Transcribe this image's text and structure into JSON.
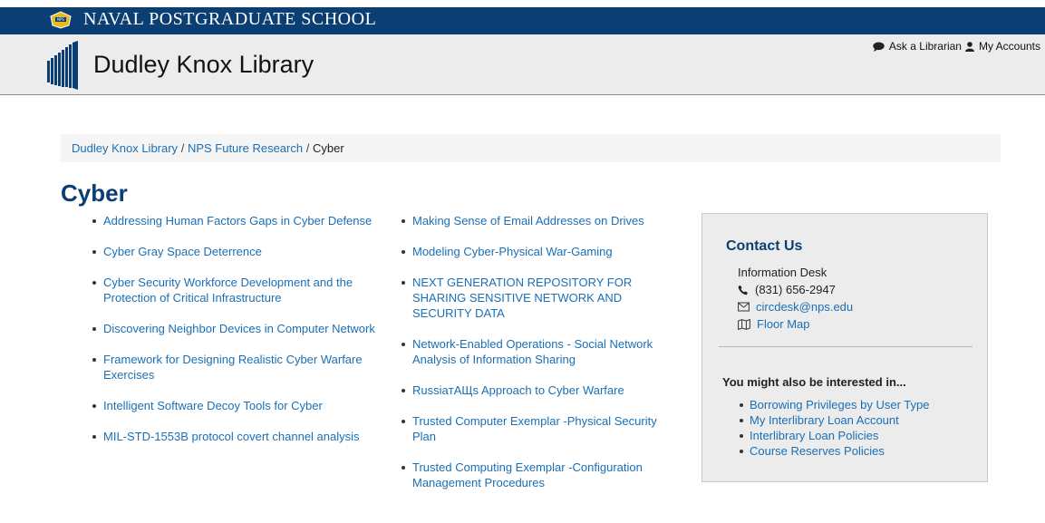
{
  "header": {
    "school_name": "NAVAL POSTGRADUATE SCHOOL",
    "library_name": "Dudley Knox Library",
    "nps_logo_icon": "nps-seal-icon",
    "library_logo_icon": "library-building-icon",
    "links": [
      {
        "label": "Ask a Librarian",
        "icon": "chat-bubble-icon"
      },
      {
        "label": "My Accounts",
        "icon": "user-icon"
      }
    ]
  },
  "breadcrumb": {
    "items": [
      "Dudley Knox Library",
      "NPS Future Research"
    ],
    "separator": "/",
    "current": "Cyber"
  },
  "page": {
    "title": "Cyber"
  },
  "topics": {
    "column1": [
      "Addressing Human Factors Gaps in Cyber Defense",
      "Cyber Gray Space Deterrence",
      "Cyber Security Workforce Development and the Protection of Critical Infrastructure",
      "Discovering Neighbor Devices in Computer Network",
      "Framework for Designing Realistic Cyber Warfare Exercises",
      "Intelligent Software Decoy Tools for Cyber",
      "MIL-STD-1553B protocol covert channel analysis"
    ],
    "column2": [
      "Making Sense of Email Addresses on Drives",
      "Modeling Cyber-Physical War-Gaming",
      "NEXT GENERATION REPOSITORY FOR SHARING SENSITIVE NETWORK AND SECURITY DATA",
      "Network-Enabled Operations - Social Network Analysis of Information Sharing",
      "RussiaтАЩs Approach to Cyber Warfare",
      "Trusted Computer Exemplar -Physical Security Plan",
      "Trusted Computing Exemplar -Configuration Management Procedures"
    ]
  },
  "sidebar": {
    "contact_title": "Contact Us",
    "desk_name": "Information Desk",
    "phone": "(831) 656-2947",
    "email": "circdesk@nps.edu",
    "map_label": "Floor Map",
    "also_title": "You might also be interested in...",
    "also_links": [
      "Borrowing Privileges by User Type",
      "My Interlibrary Loan Account",
      "Interlibrary Loan Policies",
      "Course Reserves Policies"
    ]
  },
  "colors": {
    "navy": "#0b3f73",
    "link": "#1a6fb5",
    "header_gray": "#ececec"
  }
}
